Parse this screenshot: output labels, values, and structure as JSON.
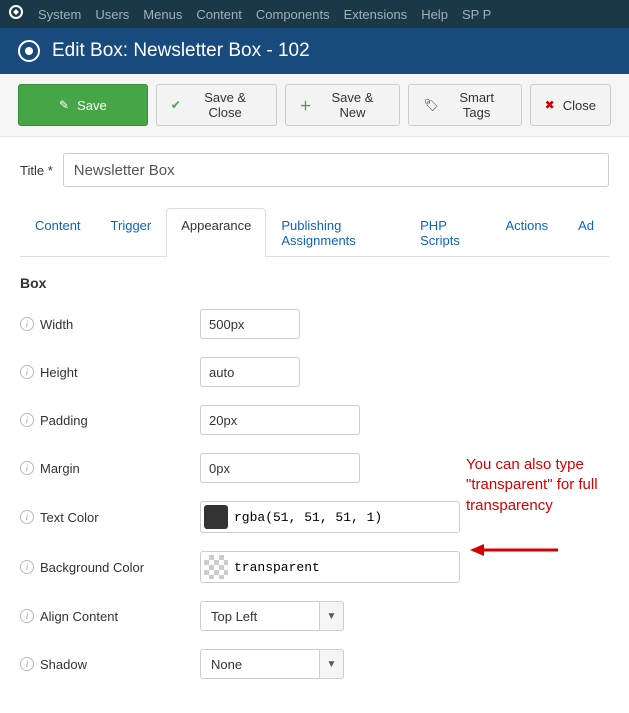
{
  "topbar": {
    "items": [
      "System",
      "Users",
      "Menus",
      "Content",
      "Components",
      "Extensions",
      "Help",
      "SP P"
    ]
  },
  "page_header": "Edit Box: Newsletter Box - 102",
  "toolbar": {
    "save": "Save",
    "save_close": "Save & Close",
    "save_new": "Save & New",
    "smart_tags": "Smart Tags",
    "close": "Close"
  },
  "title_label": "Title *",
  "title_value": "Newsletter Box",
  "tabs": [
    "Content",
    "Trigger",
    "Appearance",
    "Publishing Assignments",
    "PHP Scripts",
    "Actions",
    "Ad"
  ],
  "active_tab_index": 2,
  "section_title": "Box",
  "fields": {
    "width": {
      "label": "Width",
      "value": "500px"
    },
    "height": {
      "label": "Height",
      "value": "auto"
    },
    "padding": {
      "label": "Padding",
      "value": "20px"
    },
    "margin": {
      "label": "Margin",
      "value": "0px"
    },
    "text_color": {
      "label": "Text Color",
      "value": "rgba(51, 51, 51, 1)"
    },
    "bg_color": {
      "label": "Background Color",
      "value": "transparent"
    },
    "align": {
      "label": "Align Content",
      "value": "Top Left"
    },
    "shadow": {
      "label": "Shadow",
      "value": "None"
    }
  },
  "annotation": "You can also type \"transparent\" for full transparency"
}
